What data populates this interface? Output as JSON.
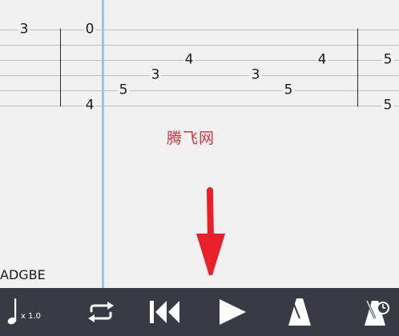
{
  "tab": {
    "tuning": "ADGBE",
    "frets": [
      {
        "id": "m1-s1",
        "value": "3"
      },
      {
        "id": "m2-s1",
        "value": "0"
      },
      {
        "id": "m2-s5",
        "value": "5"
      },
      {
        "id": "m2-s4",
        "value": "3"
      },
      {
        "id": "m2-s3",
        "value": "4"
      },
      {
        "id": "m2-s6",
        "value": "4"
      },
      {
        "id": "m2-s4b",
        "value": "3"
      },
      {
        "id": "m2-s5b",
        "value": "5"
      },
      {
        "id": "m2-s3b",
        "value": "4"
      },
      {
        "id": "m3-s3",
        "value": "5"
      },
      {
        "id": "m3-s6",
        "value": "5"
      }
    ]
  },
  "watermark": "腾飞网",
  "toolbar": {
    "speed_label": "x 1.0",
    "buttons": [
      {
        "name": "speed-button",
        "icon": "music-note-icon"
      },
      {
        "name": "loop-button",
        "icon": "repeat-icon"
      },
      {
        "name": "rewind-button",
        "icon": "skip-back-icon"
      },
      {
        "name": "play-button",
        "icon": "play-icon"
      },
      {
        "name": "metronome-button",
        "icon": "metronome-icon"
      },
      {
        "name": "count-in-button",
        "icon": "metronome-timer-icon"
      }
    ]
  },
  "colors": {
    "toolbar_bg": "#383b43",
    "cursor": "#9cc4ee",
    "watermark": "#d9353f",
    "annotation_arrow": "#e8202a"
  }
}
